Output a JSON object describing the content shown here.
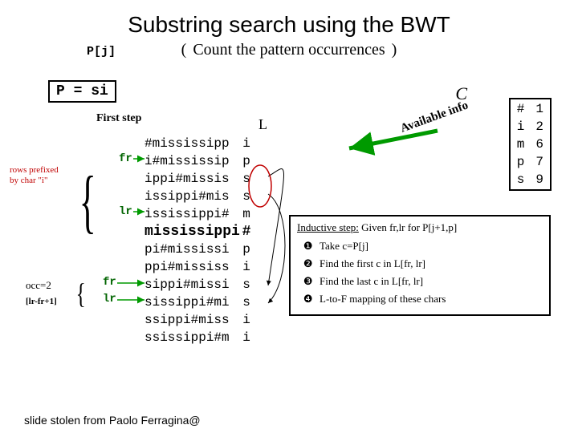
{
  "title": "Substring search using the BWT",
  "subtitle_prefix": "P[j]",
  "subtitle": "Count the pattern occurrences",
  "p_equals": "P = si",
  "c_label": "C",
  "first_step_label": "First step",
  "L_label": "L",
  "annotation_label": "Available info",
  "rows_prefixed_line1": "rows prefixed",
  "rows_prefixed_line2": "by char \"i\"",
  "fr_label": "fr",
  "lr_label": "lr",
  "occ_label": "occ=2",
  "range_label": "[lr-fr+1]",
  "bwt_rows": [
    {
      "body": "#mississipp",
      "last": "i",
      "bold": false
    },
    {
      "body": "i#mississip",
      "last": "p",
      "bold": false
    },
    {
      "body": "ippi#missis",
      "last": "s",
      "bold": false
    },
    {
      "body": "issippi#mis",
      "last": "s",
      "bold": false
    },
    {
      "body": "ississippi#",
      "last": "m",
      "bold": false
    },
    {
      "body": "mississippi",
      "last": "#",
      "bold": true
    },
    {
      "body": "pi#mississi",
      "last": "p",
      "bold": false
    },
    {
      "body": "ppi#mississ",
      "last": "i",
      "bold": false
    },
    {
      "body": "sippi#missi",
      "last": "s",
      "bold": false
    },
    {
      "body": "sissippi#mi",
      "last": "s",
      "bold": false
    },
    {
      "body": "ssippi#miss",
      "last": "i",
      "bold": false
    },
    {
      "body": "ssissippi#m",
      "last": "i",
      "bold": false
    }
  ],
  "c_table": [
    {
      "ch": "#",
      "val": "1"
    },
    {
      "ch": "i",
      "val": "2"
    },
    {
      "ch": "m",
      "val": "6"
    },
    {
      "ch": "p",
      "val": "7"
    },
    {
      "ch": "s",
      "val": "9"
    }
  ],
  "inductive": {
    "header_prefix": "Inductive step:",
    "header_rest": " Given fr,lr for P[j+1,p]",
    "steps": [
      "Take c=P[j]",
      "Find the first c in L[fr, lr]",
      "Find the last c in L[fr, lr]",
      "L-to-F mapping of these chars"
    ]
  },
  "credit": "slide stolen from Paolo Ferragina@"
}
